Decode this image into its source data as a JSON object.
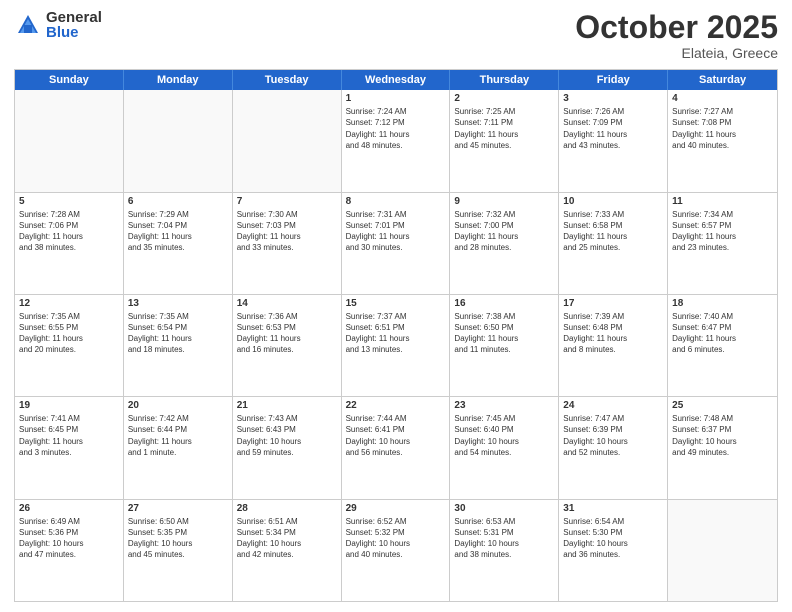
{
  "header": {
    "logo_general": "General",
    "logo_blue": "Blue",
    "month_title": "October 2025",
    "location": "Elateia, Greece"
  },
  "days_of_week": [
    "Sunday",
    "Monday",
    "Tuesday",
    "Wednesday",
    "Thursday",
    "Friday",
    "Saturday"
  ],
  "rows": [
    [
      {
        "day": "",
        "text": "",
        "empty": true
      },
      {
        "day": "",
        "text": "",
        "empty": true
      },
      {
        "day": "",
        "text": "",
        "empty": true
      },
      {
        "day": "1",
        "text": "Sunrise: 7:24 AM\nSunset: 7:12 PM\nDaylight: 11 hours\nand 48 minutes.",
        "empty": false
      },
      {
        "day": "2",
        "text": "Sunrise: 7:25 AM\nSunset: 7:11 PM\nDaylight: 11 hours\nand 45 minutes.",
        "empty": false
      },
      {
        "day": "3",
        "text": "Sunrise: 7:26 AM\nSunset: 7:09 PM\nDaylight: 11 hours\nand 43 minutes.",
        "empty": false
      },
      {
        "day": "4",
        "text": "Sunrise: 7:27 AM\nSunset: 7:08 PM\nDaylight: 11 hours\nand 40 minutes.",
        "empty": false
      }
    ],
    [
      {
        "day": "5",
        "text": "Sunrise: 7:28 AM\nSunset: 7:06 PM\nDaylight: 11 hours\nand 38 minutes.",
        "empty": false
      },
      {
        "day": "6",
        "text": "Sunrise: 7:29 AM\nSunset: 7:04 PM\nDaylight: 11 hours\nand 35 minutes.",
        "empty": false
      },
      {
        "day": "7",
        "text": "Sunrise: 7:30 AM\nSunset: 7:03 PM\nDaylight: 11 hours\nand 33 minutes.",
        "empty": false
      },
      {
        "day": "8",
        "text": "Sunrise: 7:31 AM\nSunset: 7:01 PM\nDaylight: 11 hours\nand 30 minutes.",
        "empty": false
      },
      {
        "day": "9",
        "text": "Sunrise: 7:32 AM\nSunset: 7:00 PM\nDaylight: 11 hours\nand 28 minutes.",
        "empty": false
      },
      {
        "day": "10",
        "text": "Sunrise: 7:33 AM\nSunset: 6:58 PM\nDaylight: 11 hours\nand 25 minutes.",
        "empty": false
      },
      {
        "day": "11",
        "text": "Sunrise: 7:34 AM\nSunset: 6:57 PM\nDaylight: 11 hours\nand 23 minutes.",
        "empty": false
      }
    ],
    [
      {
        "day": "12",
        "text": "Sunrise: 7:35 AM\nSunset: 6:55 PM\nDaylight: 11 hours\nand 20 minutes.",
        "empty": false
      },
      {
        "day": "13",
        "text": "Sunrise: 7:35 AM\nSunset: 6:54 PM\nDaylight: 11 hours\nand 18 minutes.",
        "empty": false
      },
      {
        "day": "14",
        "text": "Sunrise: 7:36 AM\nSunset: 6:53 PM\nDaylight: 11 hours\nand 16 minutes.",
        "empty": false
      },
      {
        "day": "15",
        "text": "Sunrise: 7:37 AM\nSunset: 6:51 PM\nDaylight: 11 hours\nand 13 minutes.",
        "empty": false
      },
      {
        "day": "16",
        "text": "Sunrise: 7:38 AM\nSunset: 6:50 PM\nDaylight: 11 hours\nand 11 minutes.",
        "empty": false
      },
      {
        "day": "17",
        "text": "Sunrise: 7:39 AM\nSunset: 6:48 PM\nDaylight: 11 hours\nand 8 minutes.",
        "empty": false
      },
      {
        "day": "18",
        "text": "Sunrise: 7:40 AM\nSunset: 6:47 PM\nDaylight: 11 hours\nand 6 minutes.",
        "empty": false
      }
    ],
    [
      {
        "day": "19",
        "text": "Sunrise: 7:41 AM\nSunset: 6:45 PM\nDaylight: 11 hours\nand 3 minutes.",
        "empty": false
      },
      {
        "day": "20",
        "text": "Sunrise: 7:42 AM\nSunset: 6:44 PM\nDaylight: 11 hours\nand 1 minute.",
        "empty": false
      },
      {
        "day": "21",
        "text": "Sunrise: 7:43 AM\nSunset: 6:43 PM\nDaylight: 10 hours\nand 59 minutes.",
        "empty": false
      },
      {
        "day": "22",
        "text": "Sunrise: 7:44 AM\nSunset: 6:41 PM\nDaylight: 10 hours\nand 56 minutes.",
        "empty": false
      },
      {
        "day": "23",
        "text": "Sunrise: 7:45 AM\nSunset: 6:40 PM\nDaylight: 10 hours\nand 54 minutes.",
        "empty": false
      },
      {
        "day": "24",
        "text": "Sunrise: 7:47 AM\nSunset: 6:39 PM\nDaylight: 10 hours\nand 52 minutes.",
        "empty": false
      },
      {
        "day": "25",
        "text": "Sunrise: 7:48 AM\nSunset: 6:37 PM\nDaylight: 10 hours\nand 49 minutes.",
        "empty": false
      }
    ],
    [
      {
        "day": "26",
        "text": "Sunrise: 6:49 AM\nSunset: 5:36 PM\nDaylight: 10 hours\nand 47 minutes.",
        "empty": false
      },
      {
        "day": "27",
        "text": "Sunrise: 6:50 AM\nSunset: 5:35 PM\nDaylight: 10 hours\nand 45 minutes.",
        "empty": false
      },
      {
        "day": "28",
        "text": "Sunrise: 6:51 AM\nSunset: 5:34 PM\nDaylight: 10 hours\nand 42 minutes.",
        "empty": false
      },
      {
        "day": "29",
        "text": "Sunrise: 6:52 AM\nSunset: 5:32 PM\nDaylight: 10 hours\nand 40 minutes.",
        "empty": false
      },
      {
        "day": "30",
        "text": "Sunrise: 6:53 AM\nSunset: 5:31 PM\nDaylight: 10 hours\nand 38 minutes.",
        "empty": false
      },
      {
        "day": "31",
        "text": "Sunrise: 6:54 AM\nSunset: 5:30 PM\nDaylight: 10 hours\nand 36 minutes.",
        "empty": false
      },
      {
        "day": "",
        "text": "",
        "empty": true
      }
    ]
  ]
}
